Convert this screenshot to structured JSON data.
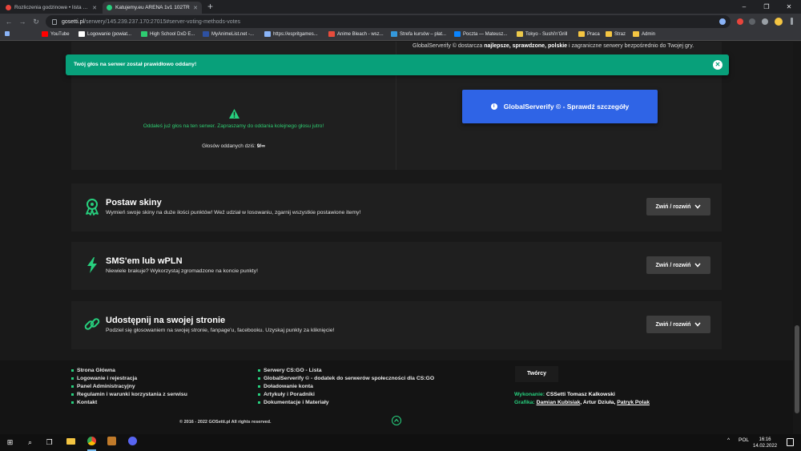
{
  "browser": {
    "tabs": [
      {
        "title": "Rozliczenia godzinowe • lista wa",
        "active": false,
        "favicon_color": "#e8453c"
      },
      {
        "title": "Katujemy.eu ARENA 1v1 102TR",
        "active": true,
        "favicon_color": "#27d07e"
      }
    ],
    "new_tab": "+",
    "window_controls": [
      "–",
      "❐",
      "✕"
    ],
    "url_host": "gosetti.pl",
    "url_path": "/serwery/145.239.237.170:27015#server-voting-methods-votes",
    "bookmarks": [
      {
        "label": "YouTube",
        "icon_color": "#ff0000"
      },
      {
        "label": "Logowanie (powiat...",
        "icon_color": "#ffffff"
      },
      {
        "label": "High School DxD E...",
        "icon_color": "#2ecc71"
      },
      {
        "label": "MyAnimeList.net -...",
        "icon_color": "#2e51a2"
      },
      {
        "label": "https://espritgames...",
        "icon_color": "#8ab4f8"
      },
      {
        "label": "Anime Bleach - wsz...",
        "icon_color": "#e74c3c"
      },
      {
        "label": "Strefa kursów – plat...",
        "icon_color": "#3498db"
      },
      {
        "label": "Poczta — Mateusz...",
        "icon_color": "#0a84ff"
      },
      {
        "label": "Tokyo - Sushi'n'Grill",
        "icon_color": "#ecc94b"
      },
      {
        "label": "Praca",
        "icon_color": "#f4c542"
      },
      {
        "label": "Straz",
        "icon_color": "#f4c542"
      },
      {
        "label": "Admin",
        "icon_color": "#f4c542"
      }
    ]
  },
  "alert": {
    "message": "Twój głos na serwer został prawidłowo oddany!",
    "close": "✕"
  },
  "vote_panel": {
    "promo_prefix": "GlobalServerify © dostarcza ",
    "promo_bold": "najlepsze, sprawdzone, polskie",
    "promo_suffix": " i zagraniczne serwery bezpośrednio do Twojej gry.",
    "voted_message": "Oddałeś już głos na ten serwer. Zapraszamy do oddania kolejnego głosu jutro!",
    "votes_today_label": "Głosów oddanych dziś: ",
    "votes_today_value": "9/∞",
    "button_label": "GlobalServerify © - Sprawdź szczegóły",
    "button_info": "i"
  },
  "sections": [
    {
      "title": "Postaw skiny",
      "description": "Wymień swoje skiny na duże ilości punktów! Weź udział w losowaniu, zgarnij wszystkie postawione itemy!",
      "icon": "award-icon",
      "toggle_label": "Zwiń / rozwiń"
    },
    {
      "title": "SMS'em lub wPLN",
      "description": "Niewiele brakuje? Wykorzystaj zgromadzone na koncie punkty!",
      "icon": "lightning-icon",
      "toggle_label": "Zwiń / rozwiń"
    },
    {
      "title": "Udostępnij na swojej stronie",
      "description": "Podziel się głosowaniem na swojej stronie, fanpage'u, facebooku. Uzyskaj punkty za kliknięcie!",
      "icon": "link-icon",
      "toggle_label": "Zwiń / rozwiń"
    }
  ],
  "footer": {
    "col1": [
      "Strona Główna",
      "Logowanie i rejestracja",
      "Panel Administracyjny",
      "Regulamin i warunki korzystania z serwisu",
      "Kontakt"
    ],
    "col2": [
      "Serwery CS:GO - Lista",
      "GlobalServerify © - dodatek do serwerów społeczności dla CS:GO",
      "Doładowanie konta",
      "Artykuły i Poradniki",
      "Dokumentacje i Materiały"
    ],
    "tworcy_label": "Twórcy",
    "wykonanie_label": "Wykonanie:",
    "wykonanie_value": "CSSetti Tomasz Kalkowski",
    "grafika_label": "Grafika:",
    "grafika_1": "Damian Kubisiak",
    "grafika_sep1": ", Artur Dziuła, ",
    "grafika_2": "Patryk Polak",
    "copyright": "© 2016 - 2022 GOSetti.pl All rights reserved."
  },
  "taskbar": {
    "lang": "POL",
    "time": "16:16",
    "date": "14.02.2022"
  },
  "colors": {
    "accent_green": "#27d07e",
    "alert_bg": "#08a07a",
    "button_blue": "#2f64e6"
  }
}
